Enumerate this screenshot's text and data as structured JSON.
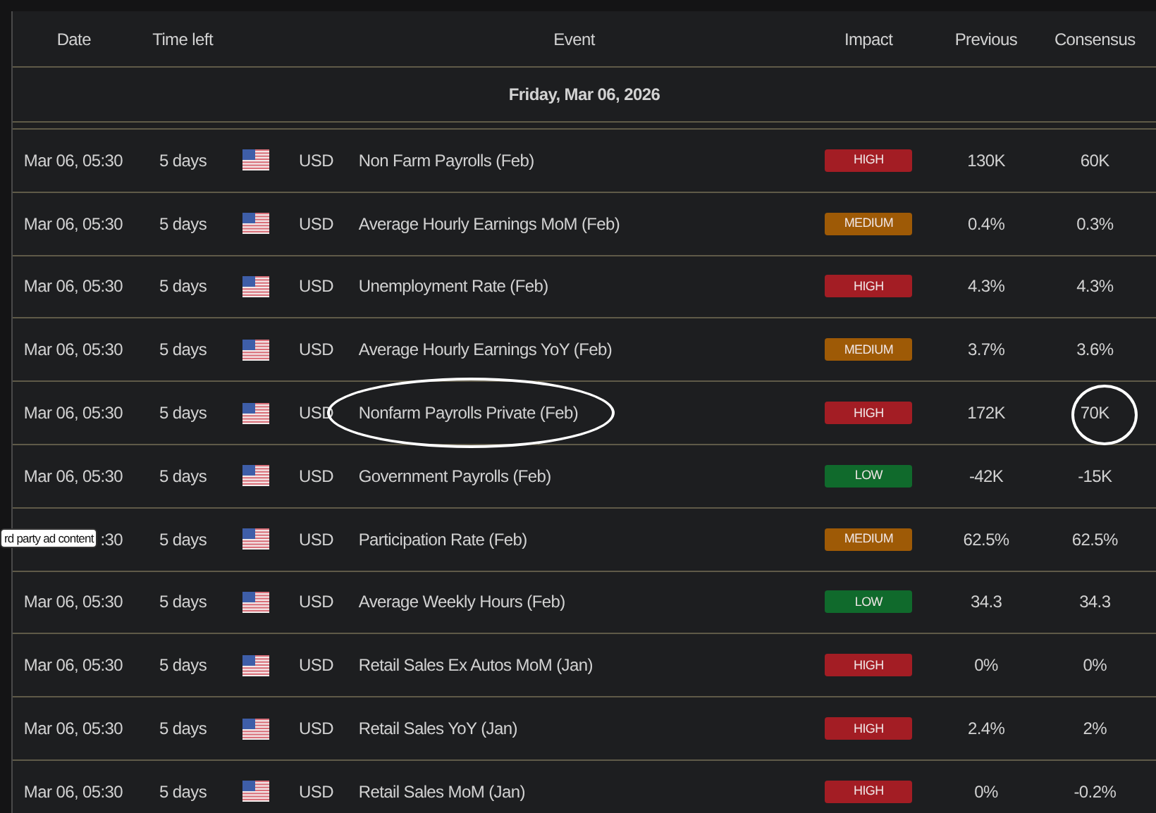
{
  "columns": [
    "Date",
    "Time left",
    "Event",
    "Impact",
    "Previous",
    "Consensus"
  ],
  "day": "Friday, Mar 06, 2026",
  "rows": [
    {
      "date": "Mar 06, 05:30",
      "time_left": "5 days",
      "currency": "USD",
      "event": "Non Farm Payrolls (Feb)",
      "impact": {
        "label": "HIGH",
        "color": "#a31d24"
      },
      "previous": "130K",
      "consensus": "60K"
    },
    {
      "date": "Mar 06, 05:30",
      "time_left": "5 days",
      "currency": "USD",
      "event": "Average Hourly Earnings MoM (Feb)",
      "impact": {
        "label": "MEDIUM",
        "color": "#9e5a06"
      },
      "previous": "0.4%",
      "consensus": "0.3%"
    },
    {
      "date": "Mar 06, 05:30",
      "time_left": "5 days",
      "currency": "USD",
      "event": "Unemployment Rate (Feb)",
      "impact": {
        "label": "HIGH",
        "color": "#a31d24"
      },
      "previous": "4.3%",
      "consensus": "4.3%"
    },
    {
      "date": "Mar 06, 05:30",
      "time_left": "5 days",
      "currency": "USD",
      "event": "Average Hourly Earnings YoY (Feb)",
      "impact": {
        "label": "MEDIUM",
        "color": "#9e5a06"
      },
      "previous": "3.7%",
      "consensus": "3.6%"
    },
    {
      "date": "Mar 06, 05:30",
      "time_left": "5 days",
      "currency": "USD",
      "event": "Nonfarm Payrolls Private (Feb)",
      "event_circled": true,
      "impact": {
        "label": "HIGH",
        "color": "#a31d24"
      },
      "previous": "172K",
      "consensus": "70K",
      "consensus_circled": true
    },
    {
      "date": "Mar 06, 05:30",
      "time_left": "5 days",
      "currency": "USD",
      "event": "Government Payrolls (Feb)",
      "impact": {
        "label": "LOW",
        "color": "#106a2c"
      },
      "previous": "-42K",
      "consensus": "-15K"
    },
    {
      "date": ":30",
      "tooltip": "rd party ad content",
      "time_left": "5 days",
      "currency": "USD",
      "event": "Participation Rate (Feb)",
      "impact": {
        "label": "MEDIUM",
        "color": "#9e5a06"
      },
      "previous": "62.5%",
      "consensus": "62.5%"
    },
    {
      "date": "Mar 06, 05:30",
      "time_left": "5 days",
      "currency": "USD",
      "event": "Average Weekly Hours (Feb)",
      "impact": {
        "label": "LOW",
        "color": "#106a2c"
      },
      "previous": "34.3",
      "consensus": "34.3"
    },
    {
      "date": "Mar 06, 05:30",
      "time_left": "5 days",
      "currency": "USD",
      "event": "Retail Sales Ex Autos MoM (Jan)",
      "impact": {
        "label": "HIGH",
        "color": "#a31d24"
      },
      "previous": "0%",
      "consensus": "0%"
    },
    {
      "date": "Mar 06, 05:30",
      "time_left": "5 days",
      "currency": "USD",
      "event": "Retail Sales YoY (Jan)",
      "impact": {
        "label": "HIGH",
        "color": "#a31d24"
      },
      "previous": "2.4%",
      "consensus": "2%"
    },
    {
      "date": "Mar 06, 05:30",
      "time_left": "5 days",
      "currency": "USD",
      "event": "Retail Sales MoM (Jan)",
      "impact": {
        "label": "HIGH",
        "color": "#a31d24"
      },
      "previous": "0%",
      "consensus": "-0.2%"
    }
  ]
}
